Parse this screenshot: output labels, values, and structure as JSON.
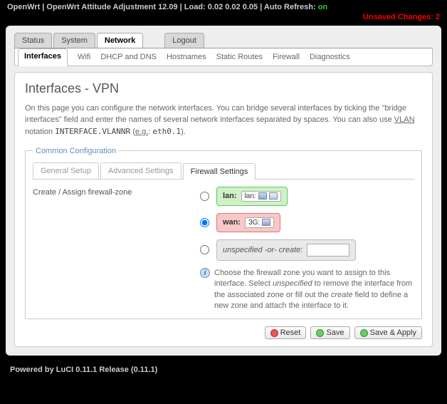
{
  "top": {
    "text": "OpenWrt | OpenWrt Attitude Adjustment 12.09 | Load: 0.02 0.02 0.05 | Auto Refresh: ",
    "on": "on",
    "unsaved": "Unsaved Changes: 2"
  },
  "tabs": {
    "status": "Status",
    "system": "System",
    "network": "Network",
    "logout": "Logout"
  },
  "subtabs": {
    "interfaces": "Interfaces",
    "wifi": "Wifi",
    "dhcp": "DHCP and DNS",
    "hostnames": "Hostnames",
    "static": "Static Routes",
    "firewall": "Firewall",
    "diag": "Diagnostics"
  },
  "page": {
    "title": "Interfaces - VPN",
    "desc1": "On this page you can configure the network interfaces. You can bridge several interfaces by ticking the \"bridge interfaces\" field and enter the names of several network interfaces separated by spaces. You can also use ",
    "vlan": "VLAN",
    "desc2": " notation ",
    "code": "INTERFACE.VLANNR",
    "desc3": " (",
    "eg": "e.g.",
    "desc4": ": ",
    "code2": "eth0.1",
    "desc5": ")."
  },
  "fieldset": {
    "legend": "Common Configuration",
    "innertabs": {
      "general": "General Setup",
      "advanced": "Advanced Settings",
      "firewall": "Firewall Settings"
    },
    "optlabel": "Create / Assign firewall-zone",
    "zones": {
      "lan_name": "lan:",
      "lan_if": "lan:",
      "wan_name": "wan:",
      "wan_if": "3G:",
      "unspec": "unspecified -or- create:"
    },
    "hint": "Choose the firewall zone you want to assign to this interface. Select ",
    "hint_unspec": "unspecified",
    "hint2": " to remove the interface from the associated zone or fill out the ",
    "hint_create": "create",
    "hint3": " field to define a new zone and attach the interface to it."
  },
  "buttons": {
    "reset": "Reset",
    "save": "Save",
    "apply": "Save & Apply"
  },
  "footer": "Powered by LuCI 0.11.1 Release (0.11.1)"
}
